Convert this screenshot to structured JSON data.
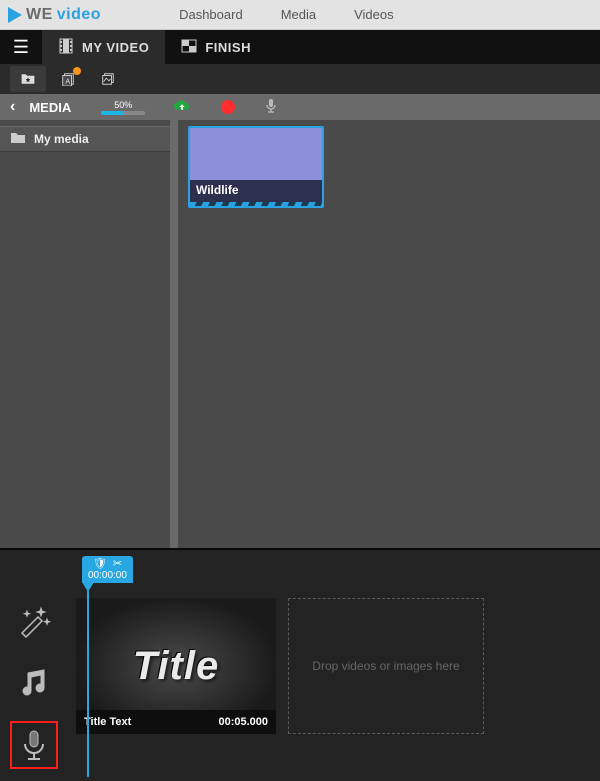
{
  "logo": {
    "part1": "We",
    "part2": "VIDEO"
  },
  "topnav": {
    "dashboard": "Dashboard",
    "media": "Media",
    "videos": "Videos"
  },
  "tabs": {
    "myvideo": "MY VIDEO",
    "finish": "FINISH"
  },
  "mediahdr": {
    "title": "MEDIA",
    "progress_label": "50%",
    "progress_pct": 50
  },
  "folders": {
    "mymedia": "My media"
  },
  "clips": {
    "wildlife": "Wildlife"
  },
  "timeline": {
    "handle_time": "00:00:00",
    "title_word": "Title",
    "title_text": "Title Text",
    "title_duration": "00:05.000",
    "dropzone": "Drop videos or images here"
  }
}
